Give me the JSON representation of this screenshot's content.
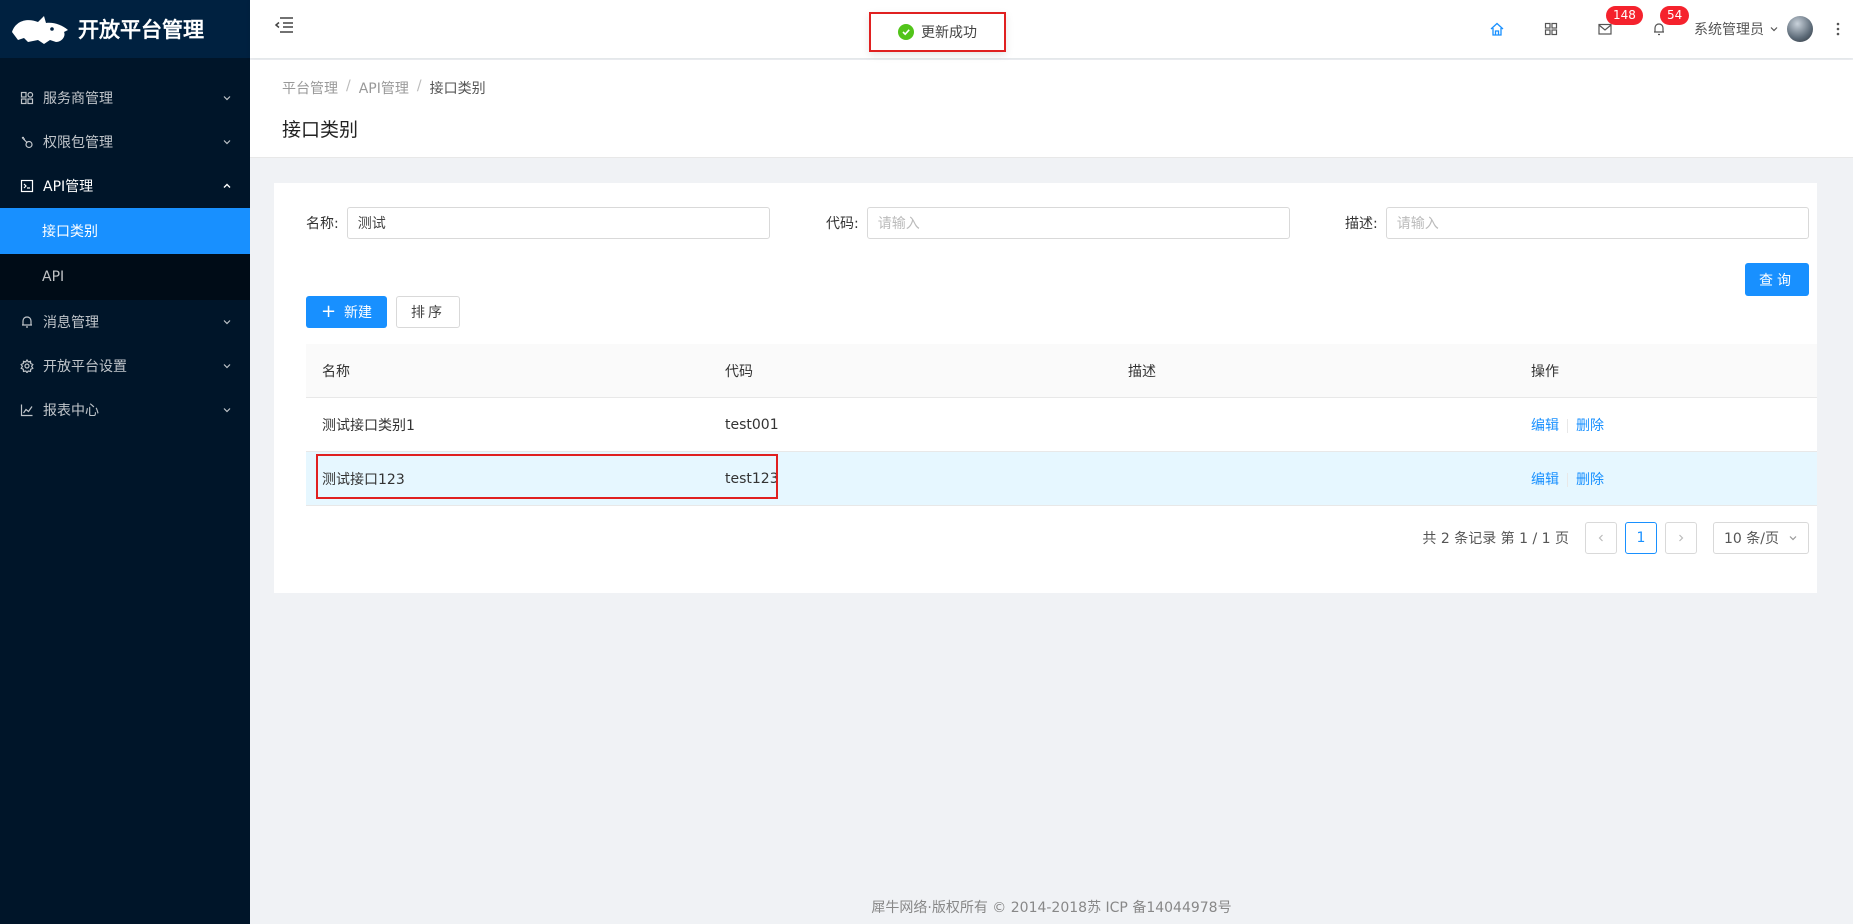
{
  "app": {
    "title": "开放平台管理"
  },
  "sidebar": {
    "items": [
      {
        "label": "服务商管理",
        "icon": "team-icon"
      },
      {
        "label": "权限包管理",
        "icon": "key-icon"
      },
      {
        "label": "API管理",
        "icon": "api-icon",
        "open": true,
        "children": [
          {
            "label": "接口类别",
            "active": true
          },
          {
            "label": "API"
          }
        ]
      },
      {
        "label": "消息管理",
        "icon": "bell-icon"
      },
      {
        "label": "开放平台设置",
        "icon": "gear-icon"
      },
      {
        "label": "报表中心",
        "icon": "chart-icon"
      }
    ]
  },
  "header": {
    "mail_badge": "148",
    "bell_badge": "54",
    "user": "系统管理员"
  },
  "toast": {
    "text": "更新成功"
  },
  "breadcrumb": [
    "平台管理",
    "API管理",
    "接口类别"
  ],
  "page_title": "接口类别",
  "filters": {
    "name_label": "名称:",
    "name_value": "测试",
    "code_label": "代码:",
    "code_placeholder": "请输入",
    "desc_label": "描述:",
    "desc_placeholder": "请输入"
  },
  "buttons": {
    "query": "查询",
    "new": "新建",
    "sort": "排序"
  },
  "table": {
    "headers": [
      "名称",
      "代码",
      "描述",
      "操作"
    ],
    "rows": [
      {
        "name": "测试接口类别1",
        "code": "test001",
        "desc": "",
        "edit": "编辑",
        "delete": "删除"
      },
      {
        "name": "测试接口123",
        "code": "test123",
        "desc": "",
        "edit": "编辑",
        "delete": "删除"
      }
    ]
  },
  "pagination": {
    "summary": "共 2 条记录 第 1 / 1 页",
    "current": "1",
    "page_size": "10 条/页"
  },
  "footer": "犀牛网络·版权所有 © 2014-2018苏 ICP 备14044978号"
}
